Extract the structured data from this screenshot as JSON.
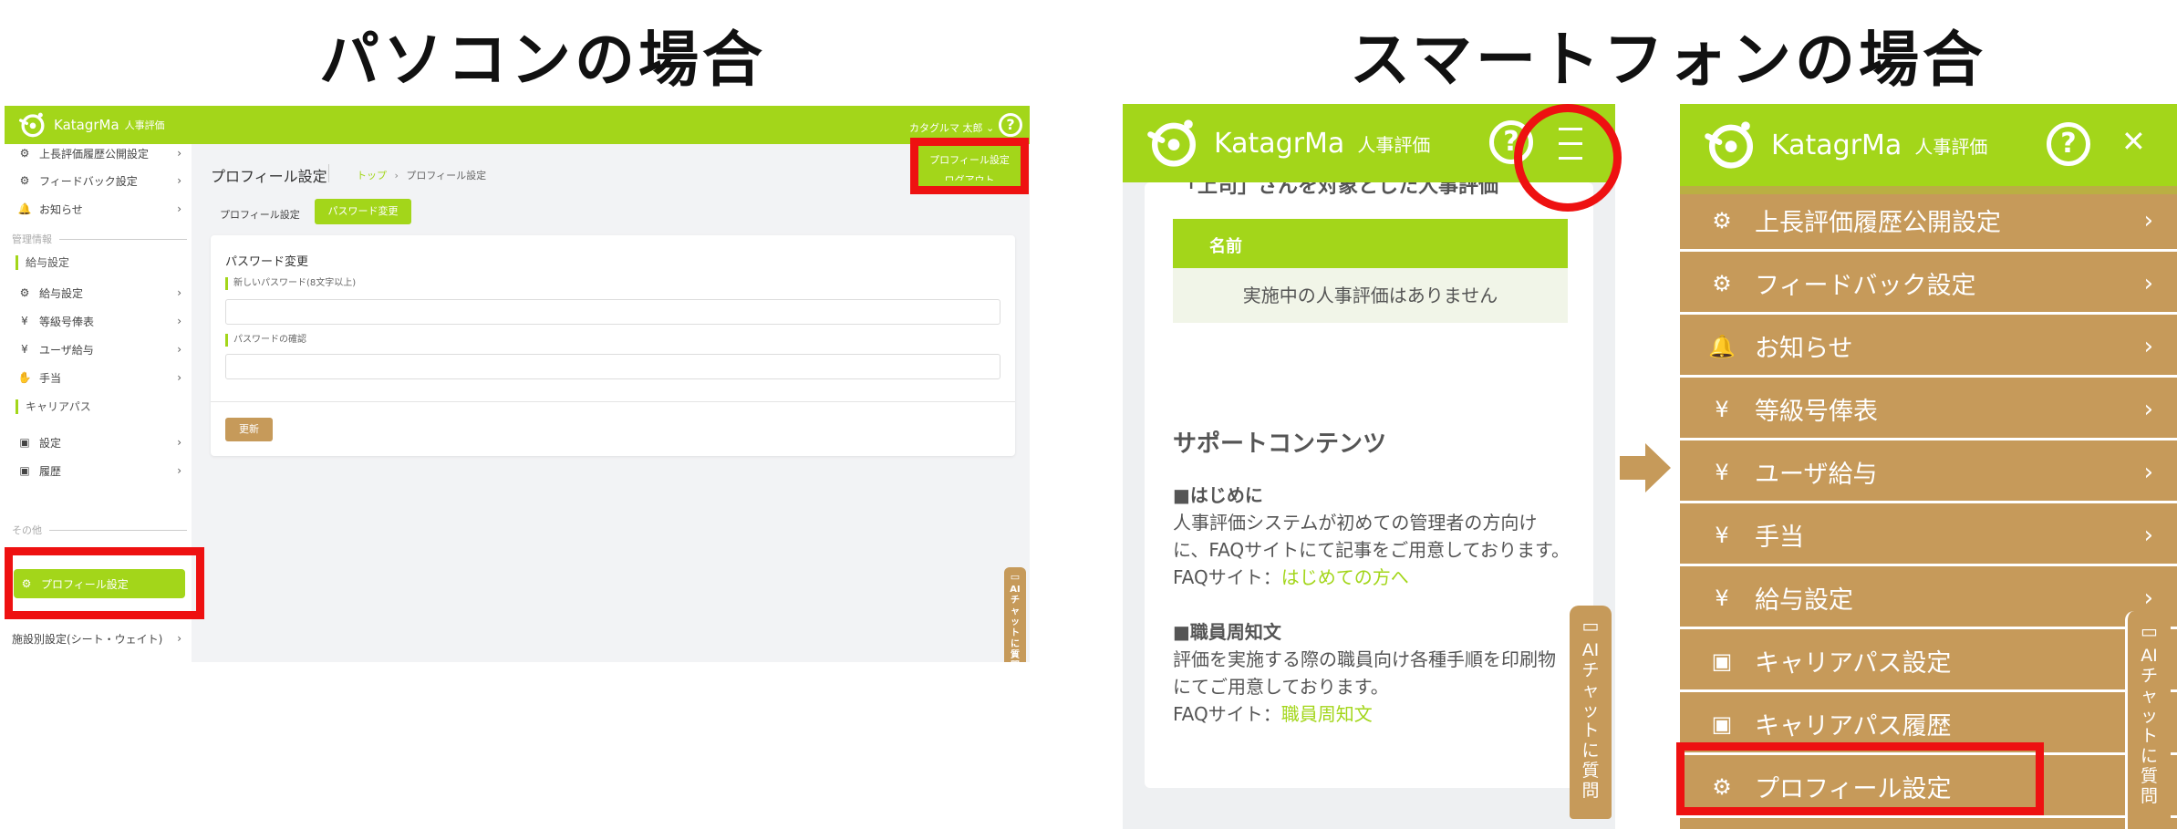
{
  "headings": {
    "pc": "パソコンの場合",
    "smartphone": "スマートフォンの場合"
  },
  "brand": {
    "name": "KatagrMa",
    "sub": "人事評価"
  },
  "colors": {
    "green": "#a3d61a",
    "brown": "#c69a5a",
    "highlight": "#ee1111"
  },
  "pc": {
    "user_name": "カタグルマ 太郎",
    "user_chevron": "⌄",
    "help_icon": "?",
    "dropdown": {
      "profile": "プロフィール設定",
      "logout": "ログアウト"
    },
    "sidebar": {
      "top_items": [
        {
          "icon": "⚙",
          "label": "上長評価履歴公開設定",
          "chev": "›"
        },
        {
          "icon": "⚙",
          "label": "フィードバック設定",
          "chev": "›"
        },
        {
          "icon": "🔔",
          "label": "お知らせ",
          "chev": "›"
        }
      ],
      "section_admin": "管理情報",
      "group_salary": "給与設定",
      "salary_items": [
        {
          "icon": "⚙",
          "label": "給与設定",
          "chev": "›"
        },
        {
          "icon": "¥",
          "label": "等級号俸表",
          "chev": "›"
        },
        {
          "icon": "¥",
          "label": "ユーザ給与",
          "chev": "›"
        },
        {
          "icon": "✋",
          "label": "手当",
          "chev": "›"
        }
      ],
      "group_career": "キャリアパス",
      "career_items": [
        {
          "icon": "▣",
          "label": "設定",
          "chev": "›"
        },
        {
          "icon": "▣",
          "label": "履歴",
          "chev": "›"
        }
      ],
      "section_other": "その他",
      "profile_item": {
        "icon": "⚙",
        "label": "プロフィール設定"
      },
      "facility_item": {
        "label": "施設別設定(シート・ウェイト)",
        "chev": "›"
      }
    },
    "page_title": "プロフィール設定",
    "breadcrumb": {
      "top": "トップ",
      "sep": "›",
      "current": "プロフィール設定"
    },
    "tabs": {
      "profile": "プロフィール設定",
      "password": "パスワード変更"
    },
    "card": {
      "title": "パスワード変更",
      "new_label": "新しいパスワード(8文字以上)",
      "confirm_label": "パスワードの確認",
      "update_button": "更新"
    },
    "ai_chat": {
      "icon": "▭",
      "label": "AIチャットに質問"
    }
  },
  "sp1": {
    "help_icon": "?",
    "partial_text": "「上司」さんを対象とした人事評価",
    "table_header": "名前",
    "empty_row": "実施中の人事評価はありません",
    "support_title": "サポートコンテンツ",
    "intro_heading": "■はじめに",
    "intro_body": "人事評価システムが初めての管理者の方向けに、FAQサイトにて記事をご用意しております。",
    "faq_prefix": "FAQサイト：",
    "intro_link": "はじめての方へ",
    "staff_heading": "■職員周知文",
    "staff_body": "評価を実施する際の職員向け各種手順を印刷物にてご用意しております。",
    "staff_link": "職員周知文",
    "ai_chat": {
      "icon": "▭",
      "label": "AIチャットに質問"
    }
  },
  "sp2": {
    "help_icon": "?",
    "close_icon": "✕",
    "menu_items": [
      {
        "icon": "⚙",
        "label": "上長評価履歴公開設定",
        "chev": "›"
      },
      {
        "icon": "⚙",
        "label": "フィードバック設定",
        "chev": "›"
      },
      {
        "icon": "🔔",
        "label": "お知らせ",
        "chev": "›"
      },
      {
        "icon": "¥",
        "label": "等級号俸表",
        "chev": "›"
      },
      {
        "icon": "¥",
        "label": "ユーザ給与",
        "chev": "›"
      },
      {
        "icon": "¥",
        "label": "手当",
        "chev": "›"
      },
      {
        "icon": "¥",
        "label": "給与設定",
        "chev": "›"
      },
      {
        "icon": "▣",
        "label": "キャリアパス設定",
        "chev": ""
      },
      {
        "icon": "▣",
        "label": "キャリアパス履歴",
        "chev": ""
      },
      {
        "icon": "⚙",
        "label": "プロフィール設定",
        "chev": ""
      }
    ],
    "ai_chat": {
      "icon": "▭",
      "label": "AIチャットに質問"
    }
  }
}
